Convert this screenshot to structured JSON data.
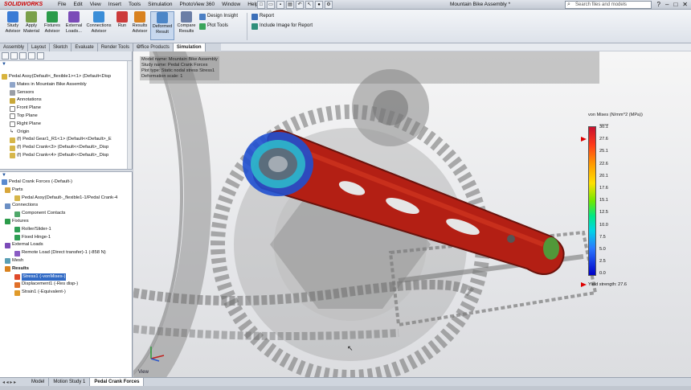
{
  "app": {
    "logo": "SOLIDWORKS",
    "menu": [
      "File",
      "Edit",
      "View",
      "Insert",
      "Tools",
      "Simulation",
      "PhotoView 360",
      "Window",
      "Help"
    ],
    "document_title": "Mountain Bike Assembly *",
    "search_placeholder": "Search files and models"
  },
  "ribbon": {
    "buttons": [
      {
        "label": "Study Advisor",
        "icon": "study-advisor-icon",
        "color": "#3a7bd5"
      },
      {
        "label": "Apply Material",
        "icon": "apply-material-icon",
        "color": "#7aa04a"
      },
      {
        "label": "Fixtures Advisor",
        "icon": "fixtures-icon",
        "color": "#2b9b4a"
      },
      {
        "label": "External Loads...",
        "icon": "external-loads-icon",
        "color": "#7b4bb8"
      },
      {
        "label": "Connections Advisor",
        "icon": "connections-icon",
        "color": "#3b8ed8"
      },
      {
        "label": "Run",
        "icon": "run-icon",
        "color": "#cc3b3b"
      },
      {
        "label": "Results Advisor",
        "icon": "results-advisor-icon",
        "color": "#d9821f"
      },
      {
        "label": "Deformed Result",
        "icon": "deformed-result-icon",
        "color": "#4c86c7"
      },
      {
        "label": "Compare Results",
        "icon": "compare-results-icon",
        "color": "#6b7ea6"
      }
    ],
    "small": [
      {
        "label": "Design Insight",
        "icon": "design-insight-icon"
      },
      {
        "label": "Plot Tools",
        "icon": "plot-tools-icon"
      },
      {
        "label": "Report",
        "icon": "report-icon"
      },
      {
        "label": "Include Image for Report",
        "icon": "include-image-icon"
      }
    ]
  },
  "tabs": [
    "Assembly",
    "Layout",
    "Sketch",
    "Evaluate",
    "Render Tools",
    "Office Products",
    "Simulation"
  ],
  "active_tab": "Simulation",
  "feature_tree": {
    "nodes": [
      {
        "label": "Pedal Assy(Default<_flexible1><1> (Default<Disp"
      },
      {
        "label": "Mates in Mountain Bike Assembly"
      },
      {
        "label": "Sensors"
      },
      {
        "label": "Annotations"
      },
      {
        "label": "Front Plane"
      },
      {
        "label": "Top Plane"
      },
      {
        "label": "Right Plane"
      },
      {
        "label": "Origin"
      },
      {
        "label": "(f) Pedal Gear1_R1<1> (Default<<Default>_E"
      },
      {
        "label": "(f) Pedal Crank<3> (Default<<Default>_Disp"
      },
      {
        "label": "(f) Pedal Crank<4> (Default<<Default>_Disp"
      }
    ]
  },
  "sim_tree": {
    "nodes": [
      {
        "label": "Pedal Crank Forces (-Default-)"
      },
      {
        "label": "Parts"
      },
      {
        "label": "Pedal Assy(Default-_flexible1-1/Pedal Crank-4"
      },
      {
        "label": "Connections"
      },
      {
        "label": "Component Contacts"
      },
      {
        "label": "Fixtures"
      },
      {
        "label": "Roller/Slider-1"
      },
      {
        "label": "Fixed Hinge-1"
      },
      {
        "label": "External Loads"
      },
      {
        "label": "Remote Load (Direct transfer)-1 (-858 N)"
      },
      {
        "label": "Mesh"
      },
      {
        "label": "Results"
      },
      {
        "label": "Stress1 (-vonMises-)"
      },
      {
        "label": "Displacement1 (-Res disp-)"
      },
      {
        "label": "Strain1 (-Equivalent-)"
      }
    ]
  },
  "viewport": {
    "info": [
      "Model name: Mountain Bike Assembly",
      "Study name: Pedal Crank Forces",
      "Plot type: Static nodal stress Stress1",
      "Deformation scale: 1"
    ],
    "legend_title": "von Mises (N/mm^2 (MPa))",
    "legend_units_hint": "××××",
    "legend_values": [
      "30.1",
      "27.6",
      "25.1",
      "22.6",
      "20.1",
      "17.6",
      "15.1",
      "12.5",
      "10.0",
      "7.5",
      "5.0",
      "2.5",
      "0.0"
    ],
    "yield": "Yield strength: 27.6",
    "view_label": "View"
  },
  "bottom_tabs": [
    "Model",
    "Motion Study 1",
    "Pedal Crank Forces"
  ],
  "active_bottom_tab": "Pedal Crank Forces"
}
